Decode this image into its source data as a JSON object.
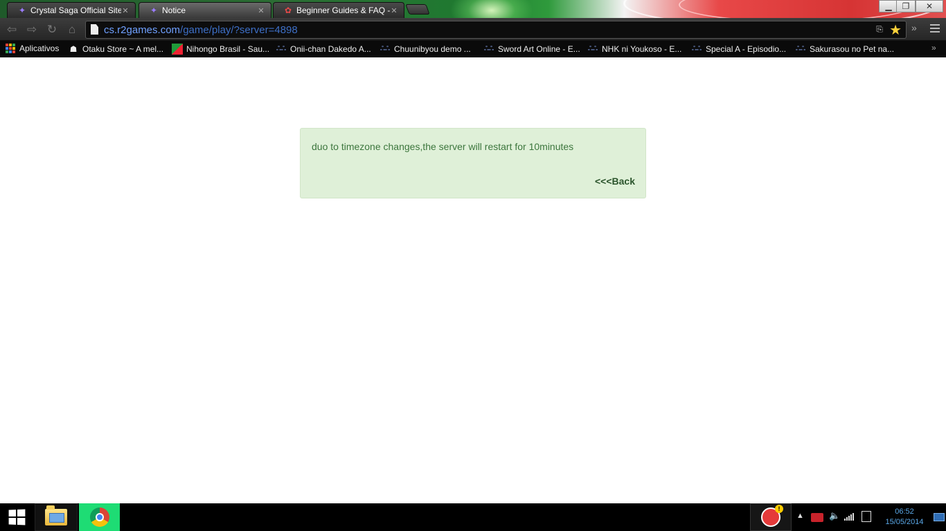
{
  "browser": {
    "tabs": [
      {
        "label": "Crystal Saga Official Site –",
        "favicon": "crystal-saga-icon",
        "active": false
      },
      {
        "label": "Notice",
        "favicon": "crystal-saga-icon",
        "active": true
      },
      {
        "label": "Beginner Guides & FAQ -",
        "favicon": "guide-icon",
        "active": false
      }
    ],
    "address": {
      "host": "cs.r2games.com",
      "path": "/game/play/?server=4898"
    },
    "bookmarks": [
      {
        "label": "Aplicativos",
        "icon": "apps-grid-icon"
      },
      {
        "label": "Otaku Store ~ A mel...",
        "icon": "otaku-store-icon"
      },
      {
        "label": "Nihongo Brasil - Sau...",
        "icon": "nihongo-brasil-icon"
      },
      {
        "label": "Onii-chan Dakedo A...",
        "icon": "anime-site-icon"
      },
      {
        "label": "Chuunibyou demo ...",
        "icon": "anime-site-icon"
      },
      {
        "label": "Sword Art Online - E...",
        "icon": "anime-site-icon"
      },
      {
        "label": "NHK ni Youkoso - E...",
        "icon": "anime-site-icon"
      },
      {
        "label": "Special A - Episodio...",
        "icon": "anime-site-icon"
      },
      {
        "label": "Sakurasou no Pet na...",
        "icon": "anime-site-icon"
      }
    ]
  },
  "notice": {
    "message": "duo to timezone changes,the server will restart for 10minutes",
    "back_label": "<<<Back"
  },
  "taskbar": {
    "time": "06:52",
    "date": "15/05/2014"
  },
  "colors": {
    "notice_bg": "#dff0d8",
    "notice_text": "#3c763d",
    "url_host": "#6fa0ff",
    "chrome_taskbar_bg": "#1edc74"
  }
}
